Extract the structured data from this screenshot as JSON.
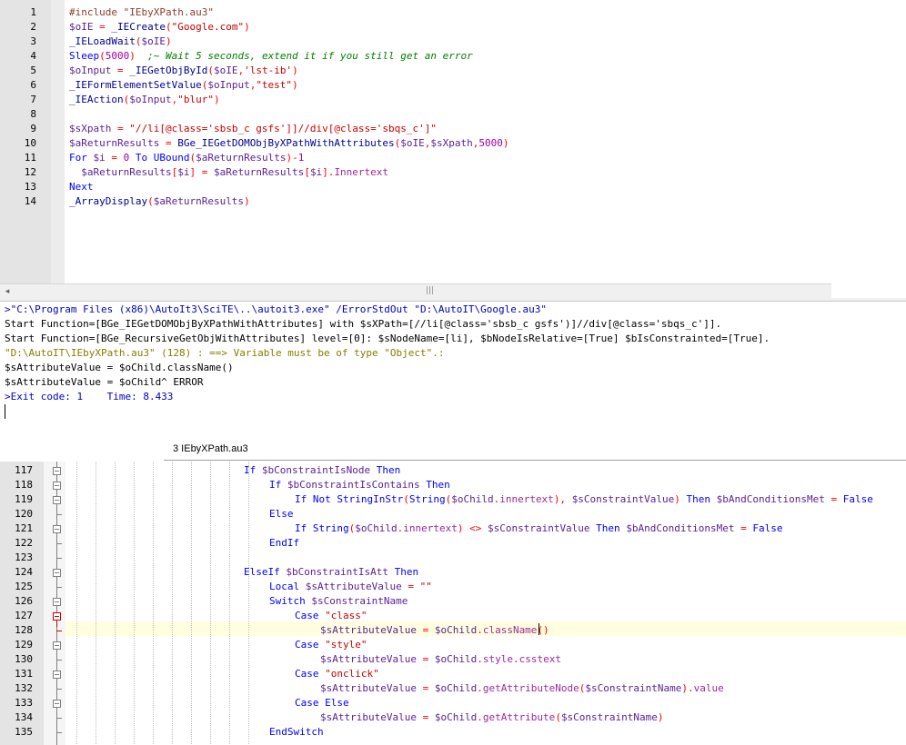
{
  "top_editor": {
    "line_numbers": [
      "1",
      "2",
      "3",
      "4",
      "5",
      "6",
      "7",
      "8",
      "9",
      "10",
      "11",
      "12",
      "13",
      "14"
    ],
    "lines": [
      [
        {
          "t": "#include \"IEbyXPath.au3\"",
          "c": "c-pre"
        }
      ],
      [
        {
          "t": "$oIE",
          "c": "c-var"
        },
        {
          "t": " = ",
          "c": "c-op"
        },
        {
          "t": "_IECreate",
          "c": "c-fn"
        },
        {
          "t": "(",
          "c": "c-op"
        },
        {
          "t": "\"Google.com\"",
          "c": "c-str"
        },
        {
          "t": ")",
          "c": "c-op"
        }
      ],
      [
        {
          "t": "_IELoadWait",
          "c": "c-fn"
        },
        {
          "t": "(",
          "c": "c-op"
        },
        {
          "t": "$oIE",
          "c": "c-var"
        },
        {
          "t": ")",
          "c": "c-op"
        }
      ],
      [
        {
          "t": "Sleep",
          "c": "c-kw"
        },
        {
          "t": "(",
          "c": "c-op"
        },
        {
          "t": "5000",
          "c": "c-num"
        },
        {
          "t": ")",
          "c": "c-op"
        },
        {
          "t": "  ;~ Wait 5 seconds, extend it if you still get an error",
          "c": "c-cmt"
        }
      ],
      [
        {
          "t": "$oInput",
          "c": "c-var"
        },
        {
          "t": " = ",
          "c": "c-op"
        },
        {
          "t": "_IEGetObjById",
          "c": "c-fn"
        },
        {
          "t": "(",
          "c": "c-op"
        },
        {
          "t": "$oIE",
          "c": "c-var"
        },
        {
          "t": ",",
          "c": "c-op"
        },
        {
          "t": "'lst-ib'",
          "c": "c-str"
        },
        {
          "t": ")",
          "c": "c-op"
        }
      ],
      [
        {
          "t": "_IEFormElementSetValue",
          "c": "c-fn"
        },
        {
          "t": "(",
          "c": "c-op"
        },
        {
          "t": "$oInput",
          "c": "c-var"
        },
        {
          "t": ",",
          "c": "c-op"
        },
        {
          "t": "\"test\"",
          "c": "c-str"
        },
        {
          "t": ")",
          "c": "c-op"
        }
      ],
      [
        {
          "t": "_IEAction",
          "c": "c-fn"
        },
        {
          "t": "(",
          "c": "c-op"
        },
        {
          "t": "$oInput",
          "c": "c-var"
        },
        {
          "t": ",",
          "c": "c-op"
        },
        {
          "t": "\"blur\"",
          "c": "c-str"
        },
        {
          "t": ")",
          "c": "c-op"
        }
      ],
      [],
      [
        {
          "t": "$sXpath",
          "c": "c-var"
        },
        {
          "t": " = ",
          "c": "c-op"
        },
        {
          "t": "\"//li[@class='sbsb_c gsfs']]//div[@class='sbqs_c']\"",
          "c": "c-str"
        }
      ],
      [
        {
          "t": "$aReturnResults",
          "c": "c-var"
        },
        {
          "t": " = ",
          "c": "c-op"
        },
        {
          "t": "BGe_IEGetDOMObjByXPathWithAttributes",
          "c": "c-fn"
        },
        {
          "t": "(",
          "c": "c-op"
        },
        {
          "t": "$oIE",
          "c": "c-var"
        },
        {
          "t": ",",
          "c": "c-op"
        },
        {
          "t": "$sXpath",
          "c": "c-var"
        },
        {
          "t": ",",
          "c": "c-op"
        },
        {
          "t": "5000",
          "c": "c-num"
        },
        {
          "t": ")",
          "c": "c-op"
        }
      ],
      [
        {
          "t": "For",
          "c": "c-kw"
        },
        {
          "t": " $i",
          "c": "c-var"
        },
        {
          "t": " = ",
          "c": "c-op"
        },
        {
          "t": "0",
          "c": "c-num"
        },
        {
          "t": " To ",
          "c": "c-kw"
        },
        {
          "t": "UBound",
          "c": "c-kw"
        },
        {
          "t": "(",
          "c": "c-op"
        },
        {
          "t": "$aReturnResults",
          "c": "c-var"
        },
        {
          "t": ")-",
          "c": "c-op"
        },
        {
          "t": "1",
          "c": "c-num"
        }
      ],
      [
        {
          "t": "  $aReturnResults",
          "c": "c-var"
        },
        {
          "t": "[",
          "c": "c-op"
        },
        {
          "t": "$i",
          "c": "c-var"
        },
        {
          "t": "] = ",
          "c": "c-op"
        },
        {
          "t": "$aReturnResults",
          "c": "c-var"
        },
        {
          "t": "[",
          "c": "c-op"
        },
        {
          "t": "$i",
          "c": "c-var"
        },
        {
          "t": "].",
          "c": "c-op"
        },
        {
          "t": "Innertext",
          "c": "c-obj"
        }
      ],
      [
        {
          "t": "Next",
          "c": "c-kw"
        }
      ],
      [
        {
          "t": "_ArrayDisplay",
          "c": "c-fn"
        },
        {
          "t": "(",
          "c": "c-op"
        },
        {
          "t": "$aReturnResults",
          "c": "c-var"
        },
        {
          "t": ")",
          "c": "c-op"
        }
      ]
    ],
    "scroll_grip": "|||"
  },
  "output": {
    "lines": [
      {
        "t": ">\"C:\\Program Files (x86)\\AutoIt3\\SciTE\\..\\autoit3.exe\" /ErrorStdOut \"D:\\AutoIT\\Google.au3\"",
        "c": "c-out-blue"
      },
      {
        "t": "Start Function=[BGe_IEGetDOMObjByXPathWithAttributes] with $sXPath=[//li[@class='sbsb_c gsfs')]//div[@class='sbqs_c']].",
        "c": "c-plain"
      },
      {
        "t": "Start Function=[BGe_RecursiveGetObjWithAttributes] level=[0]: $sNodeName=[li], $bNodeIsRelative=[True] $bIsConstrainted=[True].",
        "c": "c-plain"
      },
      {
        "t": "\"D:\\AutoIT\\IEbyXPath.au3\" (128) : ==> Variable must be of type \"Object\".:",
        "c": "c-out-olive"
      },
      {
        "t": "$sAttributeValue = $oChild.className()",
        "c": "c-plain"
      },
      {
        "t": "$sAttributeValue = $oChild^ ERROR",
        "c": "c-plain"
      },
      {
        "t": ">Exit code: 1    Time: 8.433",
        "c": "c-out-blue"
      }
    ]
  },
  "tab": {
    "label": "3 IEbyXPath.au3"
  },
  "bottom_editor": {
    "line_numbers": [
      "117",
      "118",
      "119",
      "120",
      "121",
      "122",
      "123",
      "124",
      "125",
      "126",
      "127",
      "128",
      "129",
      "130",
      "131",
      "132",
      "133",
      "134",
      "135"
    ],
    "lines": [
      {
        "indent": 24,
        "segs": [
          {
            "t": "If",
            "c": "c-kw"
          },
          {
            "t": " $bConstraintIsNode",
            "c": "c-var"
          },
          {
            "t": " Then",
            "c": "c-kw"
          }
        ]
      },
      {
        "indent": 28,
        "segs": [
          {
            "t": "If",
            "c": "c-kw"
          },
          {
            "t": " $bConstraintIsContains",
            "c": "c-var"
          },
          {
            "t": " Then",
            "c": "c-kw"
          }
        ]
      },
      {
        "indent": 32,
        "segs": [
          {
            "t": "If Not ",
            "c": "c-kw"
          },
          {
            "t": "StringInStr",
            "c": "c-kw"
          },
          {
            "t": "(",
            "c": "c-op"
          },
          {
            "t": "String",
            "c": "c-kw"
          },
          {
            "t": "(",
            "c": "c-op"
          },
          {
            "t": "$oChild",
            "c": "c-var"
          },
          {
            "t": ".",
            "c": "c-op"
          },
          {
            "t": "innertext",
            "c": "c-obj"
          },
          {
            "t": "), ",
            "c": "c-op"
          },
          {
            "t": "$sConstraintValue",
            "c": "c-var"
          },
          {
            "t": ")",
            "c": "c-op"
          },
          {
            "t": " Then ",
            "c": "c-kw"
          },
          {
            "t": "$bAndConditionsMet",
            "c": "c-var"
          },
          {
            "t": " = ",
            "c": "c-op"
          },
          {
            "t": "False",
            "c": "c-kw"
          }
        ]
      },
      {
        "indent": 28,
        "segs": [
          {
            "t": "Else",
            "c": "c-kw"
          }
        ]
      },
      {
        "indent": 32,
        "segs": [
          {
            "t": "If ",
            "c": "c-kw"
          },
          {
            "t": "String",
            "c": "c-kw"
          },
          {
            "t": "(",
            "c": "c-op"
          },
          {
            "t": "$oChild",
            "c": "c-var"
          },
          {
            "t": ".",
            "c": "c-op"
          },
          {
            "t": "innertext",
            "c": "c-obj"
          },
          {
            "t": ") <> ",
            "c": "c-op"
          },
          {
            "t": "$sConstraintValue",
            "c": "c-var"
          },
          {
            "t": " Then ",
            "c": "c-kw"
          },
          {
            "t": "$bAndConditionsMet",
            "c": "c-var"
          },
          {
            "t": " = ",
            "c": "c-op"
          },
          {
            "t": "False",
            "c": "c-kw"
          }
        ]
      },
      {
        "indent": 28,
        "segs": [
          {
            "t": "EndIf",
            "c": "c-kw"
          }
        ]
      },
      {
        "indent": 0,
        "segs": []
      },
      {
        "indent": 24,
        "segs": [
          {
            "t": "ElseIf",
            "c": "c-kw"
          },
          {
            "t": " $bConstraintIsAtt",
            "c": "c-var"
          },
          {
            "t": " Then",
            "c": "c-kw"
          }
        ]
      },
      {
        "indent": 28,
        "segs": [
          {
            "t": "Local",
            "c": "c-kw"
          },
          {
            "t": " $sAttributeValue",
            "c": "c-var"
          },
          {
            "t": " = ",
            "c": "c-op"
          },
          {
            "t": "\"\"",
            "c": "c-str"
          }
        ]
      },
      {
        "indent": 28,
        "segs": [
          {
            "t": "Switch",
            "c": "c-kw"
          },
          {
            "t": " $sConstraintName",
            "c": "c-var"
          }
        ]
      },
      {
        "indent": 32,
        "segs": [
          {
            "t": "Case",
            "c": "c-kw"
          },
          {
            "t": " \"class\"",
            "c": "c-str"
          }
        ]
      },
      {
        "indent": 36,
        "segs": [
          {
            "t": "$sAttributeValue",
            "c": "c-var"
          },
          {
            "t": " = ",
            "c": "c-op"
          },
          {
            "t": "$oChild",
            "c": "c-var"
          },
          {
            "t": ".",
            "c": "c-op"
          },
          {
            "t": "className",
            "c": "c-obj"
          },
          {
            "t": "()",
            "c": "c-op"
          }
        ]
      },
      {
        "indent": 32,
        "segs": [
          {
            "t": "Case",
            "c": "c-kw"
          },
          {
            "t": " \"style\"",
            "c": "c-str"
          }
        ]
      },
      {
        "indent": 36,
        "segs": [
          {
            "t": "$sAttributeValue",
            "c": "c-var"
          },
          {
            "t": " = ",
            "c": "c-op"
          },
          {
            "t": "$oChild",
            "c": "c-var"
          },
          {
            "t": ".",
            "c": "c-op"
          },
          {
            "t": "style",
            "c": "c-obj"
          },
          {
            "t": ".",
            "c": "c-op"
          },
          {
            "t": "csstext",
            "c": "c-obj"
          }
        ]
      },
      {
        "indent": 32,
        "segs": [
          {
            "t": "Case",
            "c": "c-kw"
          },
          {
            "t": " \"onclick\"",
            "c": "c-str"
          }
        ]
      },
      {
        "indent": 36,
        "segs": [
          {
            "t": "$sAttributeValue",
            "c": "c-var"
          },
          {
            "t": " = ",
            "c": "c-op"
          },
          {
            "t": "$oChild",
            "c": "c-var"
          },
          {
            "t": ".",
            "c": "c-op"
          },
          {
            "t": "getAttributeNode",
            "c": "c-obj"
          },
          {
            "t": "(",
            "c": "c-op"
          },
          {
            "t": "$sConstraintName",
            "c": "c-var"
          },
          {
            "t": ").",
            "c": "c-op"
          },
          {
            "t": "value",
            "c": "c-obj"
          }
        ]
      },
      {
        "indent": 32,
        "segs": [
          {
            "t": "Case Else",
            "c": "c-kw"
          }
        ]
      },
      {
        "indent": 36,
        "segs": [
          {
            "t": "$sAttributeValue",
            "c": "c-var"
          },
          {
            "t": " = ",
            "c": "c-op"
          },
          {
            "t": "$oChild",
            "c": "c-var"
          },
          {
            "t": ".",
            "c": "c-op"
          },
          {
            "t": "getAttribute",
            "c": "c-obj"
          },
          {
            "t": "(",
            "c": "c-op"
          },
          {
            "t": "$sConstraintName",
            "c": "c-var"
          },
          {
            "t": ")",
            "c": "c-op"
          }
        ]
      },
      {
        "indent": 28,
        "segs": [
          {
            "t": "EndSwitch",
            "c": "c-kw"
          }
        ]
      }
    ]
  },
  "colors": {
    "current_line_highlight": "#ffffe0",
    "fold_error_marker": "#d00000",
    "gutter": "#e4e4e4"
  },
  "icons": {
    "scroll_left": "scroll-left-arrow-icon",
    "fold_marker": "fold-minus-icon"
  }
}
